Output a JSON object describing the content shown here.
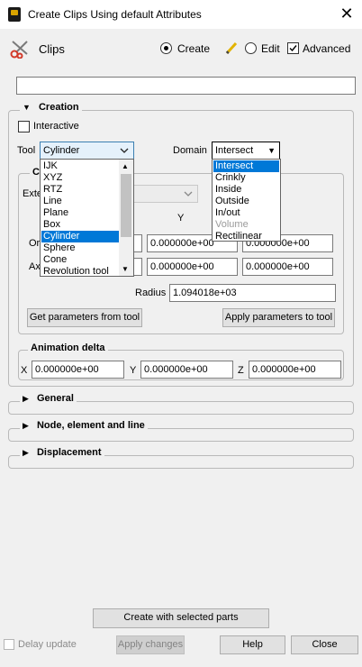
{
  "window": {
    "title": "Create Clips Using default Attributes",
    "close_glyph": "✕"
  },
  "header": {
    "section_label": "Clips",
    "modes": [
      {
        "label": "Create",
        "selected": true
      },
      {
        "label": "Edit",
        "selected": false
      }
    ],
    "advanced": {
      "label": "Advanced",
      "checked": true
    },
    "name_value": ""
  },
  "creation": {
    "title": "Creation",
    "interactive_label": "Interactive",
    "tool_label": "Tool",
    "tool_value": "Cylinder",
    "domain_label": "Domain",
    "domain_value": "Intersect",
    "tool_options": [
      "IJK",
      "XYZ",
      "RTZ",
      "Line",
      "Plane",
      "Box",
      "Cylinder",
      "Sphere",
      "Cone",
      "Revolution tool"
    ],
    "domain_options": [
      "Intersect",
      "Crinkly",
      "Inside",
      "Outside",
      "In/out",
      "Volume",
      "Rectilinear"
    ],
    "geometry": {
      "title_fragment": "C",
      "extent_fragment": "Exte",
      "col_y": "Y",
      "origin_fragment": "Or",
      "axis_fragment": "Ax",
      "origin_y": "0.000000e+00",
      "origin_z": "0.000000e+00",
      "axis_y": "0.000000e+00",
      "axis_z": "0.000000e+00",
      "radius_label": "Radius",
      "radius_value": "1.094018e+03",
      "get_params_label": "Get parameters from tool",
      "apply_params_label": "Apply parameters to tool"
    },
    "animation": {
      "title": "Animation delta",
      "x_label": "X",
      "x_value": "0.000000e+00",
      "y_label": "Y",
      "y_value": "0.000000e+00",
      "z_label": "Z",
      "z_value": "0.000000e+00"
    }
  },
  "sections": [
    {
      "title": "General"
    },
    {
      "title": "Node, element and line"
    },
    {
      "title": "Displacement"
    }
  ],
  "footer": {
    "create_label": "Create with selected parts",
    "delay_label": "Delay update",
    "apply_label": "Apply changes",
    "help_label": "Help",
    "close_label": "Close"
  }
}
